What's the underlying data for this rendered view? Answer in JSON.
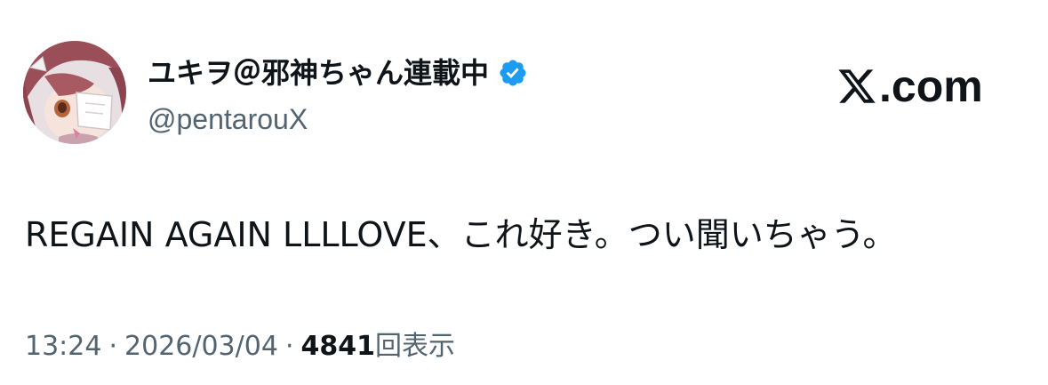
{
  "tweet": {
    "author": {
      "display_name": "ユキヲ＠邪神ちゃん連載中",
      "handle": "@pentarouX",
      "verified_icon": "verified-badge-icon"
    },
    "brand": {
      "logo_icon": "x-logo-icon",
      "label": ".com"
    },
    "text": "REGAIN AGAIN LLLLOVE、これ好き。つい聞いちゃう。",
    "meta": {
      "time": "13:24",
      "separator": "·",
      "date": "2026/03/04",
      "views_count": "4841",
      "views_label": "回表示"
    }
  },
  "colors": {
    "text_primary": "#0f1419",
    "text_secondary": "#536471",
    "verified_blue": "#1d9bf0",
    "background": "#ffffff"
  }
}
